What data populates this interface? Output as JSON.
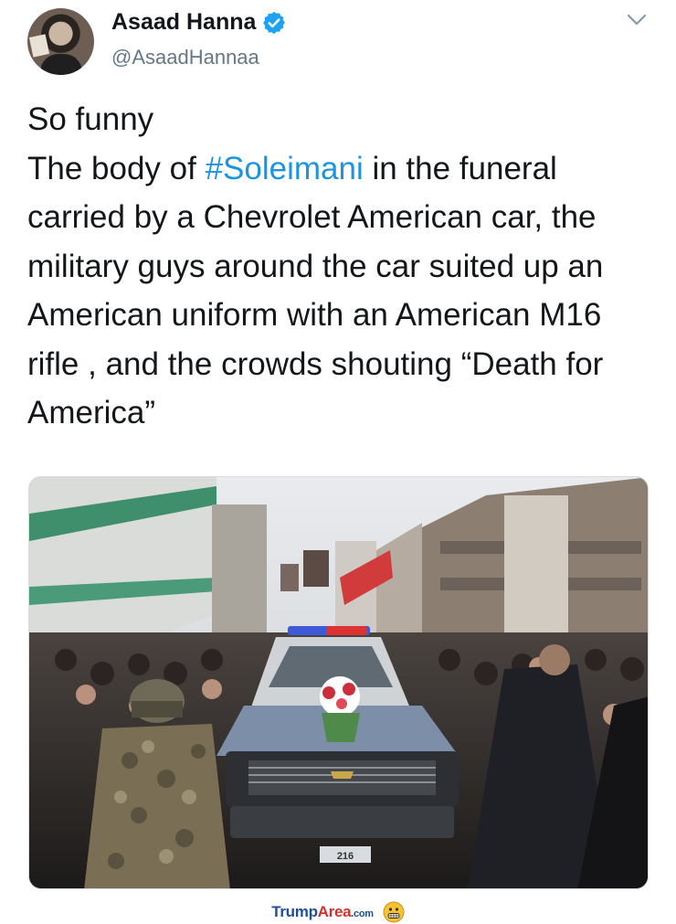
{
  "tweet": {
    "author": {
      "display_name": "Asaad Hanna",
      "handle": "@AsaadHannaa",
      "verified": true
    },
    "text": {
      "line1": "So funny",
      "line2_before": "The body of ",
      "hashtag": "#Soleimani",
      "line2_after": " in the funeral carried by a Chevrolet American car, the military guys around the car suited up an American uniform with an American M16 rifle , and the crowds shouting “Death for America”"
    },
    "photo": {
      "plate_text": "216"
    }
  },
  "footer": {
    "brand_part1": "Trump",
    "brand_part2": "Area",
    "brand_part3": ".com"
  },
  "colors": {
    "hashtag": "#1b95e0",
    "verified": "#1da1f2",
    "handle": "#657786",
    "brand_blue": "#1d4f9c",
    "brand_red": "#d32f2f"
  },
  "icons": [
    "verified-badge-icon",
    "chevron-down-icon",
    "grimacing-emoji-icon"
  ]
}
